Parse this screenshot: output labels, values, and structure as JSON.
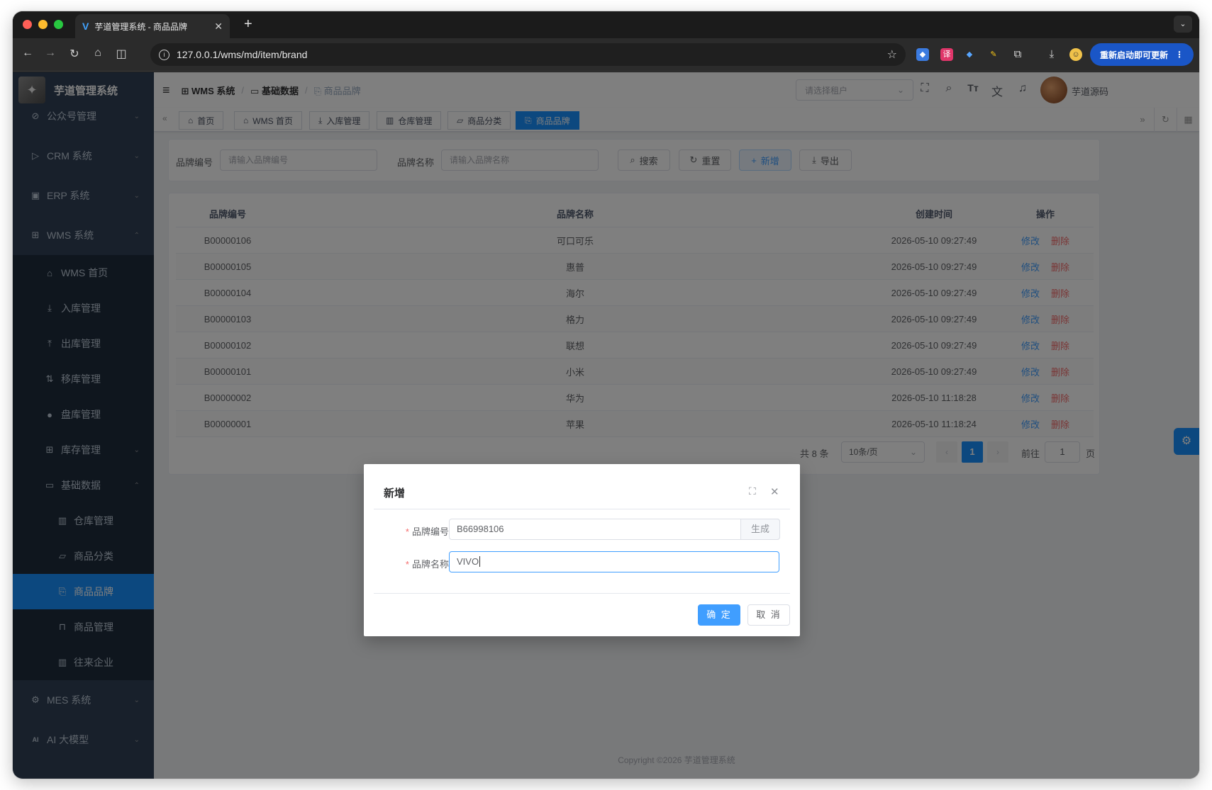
{
  "browser": {
    "tab_title": "芋道管理系统 - 商品品牌",
    "url": "127.0.0.1/wms/md/item/brand",
    "restart_label": "重新启动即可更新"
  },
  "app": {
    "title": "芋道管理系统",
    "breadcrumb": [
      "WMS 系统",
      "基础数据",
      "商品品牌"
    ],
    "tenant_placeholder": "请选择租户",
    "user_name": "芋道源码",
    "footer": "Copyright ©2026 芋道管理系统",
    "accent": "#1890ff"
  },
  "sidebar": {
    "items": [
      {
        "label": "公众号管理",
        "icon": "wechat-icon",
        "glyph": "⊘"
      },
      {
        "label": "CRM 系统",
        "icon": "crm-icon",
        "glyph": "▷"
      },
      {
        "label": "ERP 系统",
        "icon": "erp-icon",
        "glyph": "▣"
      },
      {
        "label": "WMS 系统",
        "icon": "wms-icon",
        "glyph": "⊞"
      },
      {
        "label": "WMS 首页",
        "icon": "home-icon",
        "glyph": "⌂"
      },
      {
        "label": "入库管理",
        "icon": "download-icon",
        "glyph": "⤓"
      },
      {
        "label": "出库管理",
        "icon": "upload-icon",
        "glyph": "⤒"
      },
      {
        "label": "移库管理",
        "icon": "transfer-icon",
        "glyph": "⇅"
      },
      {
        "label": "盘库管理",
        "icon": "check-icon",
        "glyph": "●"
      },
      {
        "label": "库存管理",
        "icon": "inventory-icon",
        "glyph": "⊞"
      },
      {
        "label": "基础数据",
        "icon": "box-icon",
        "glyph": "▭"
      },
      {
        "label": "仓库管理",
        "icon": "building-icon",
        "glyph": "▥"
      },
      {
        "label": "商品分类",
        "icon": "folder-icon",
        "glyph": "▱"
      },
      {
        "label": "商品品牌",
        "icon": "brand-icon",
        "glyph": "⎘"
      },
      {
        "label": "商品管理",
        "icon": "bag-icon",
        "glyph": "⊓"
      },
      {
        "label": "往来企业",
        "icon": "company-icon",
        "glyph": "▥"
      },
      {
        "label": "MES 系统",
        "icon": "mes-icon",
        "glyph": "⚙"
      },
      {
        "label": "AI 大模型",
        "icon": "ai-icon",
        "glyph": "AI"
      }
    ]
  },
  "tags": [
    "首页",
    "WMS 首页",
    "入库管理",
    "仓库管理",
    "商品分类",
    "商品品牌"
  ],
  "search": {
    "code_label": "品牌编号",
    "code_placeholder": "请输入品牌编号",
    "name_label": "品牌名称",
    "name_placeholder": "请输入品牌名称",
    "search_btn": "搜索",
    "reset_btn": "重置",
    "add_btn": "新增",
    "export_btn": "导出"
  },
  "table": {
    "columns": [
      "品牌编号",
      "品牌名称",
      "创建时间",
      "操作"
    ],
    "edit_label": "修改",
    "delete_label": "删除",
    "rows": [
      {
        "code": "B00000106",
        "name": "可口可乐",
        "time": "2026-05-10 09:27:49"
      },
      {
        "code": "B00000105",
        "name": "惠普",
        "time": "2026-05-10 09:27:49"
      },
      {
        "code": "B00000104",
        "name": "海尔",
        "time": "2026-05-10 09:27:49"
      },
      {
        "code": "B00000103",
        "name": "格力",
        "time": "2026-05-10 09:27:49"
      },
      {
        "code": "B00000102",
        "name": "联想",
        "time": "2026-05-10 09:27:49"
      },
      {
        "code": "B00000101",
        "name": "小米",
        "time": "2026-05-10 09:27:49"
      },
      {
        "code": "B00000002",
        "name": "华为",
        "time": "2026-05-10 11:18:28"
      },
      {
        "code": "B00000001",
        "name": "苹果",
        "time": "2026-05-10 11:18:24"
      }
    ]
  },
  "pagination": {
    "total": "共 8 条",
    "page_size": "10条/页",
    "current": "1",
    "goto_label": "前往",
    "goto_value": "1",
    "page_suffix": "页"
  },
  "dialog": {
    "title": "新增",
    "code_label": "品牌编号",
    "code_value": "B66998106",
    "generate_label": "生成",
    "name_label": "品牌名称",
    "name_value": "VIVO",
    "ok_label": "确 定",
    "cancel_label": "取 消"
  }
}
